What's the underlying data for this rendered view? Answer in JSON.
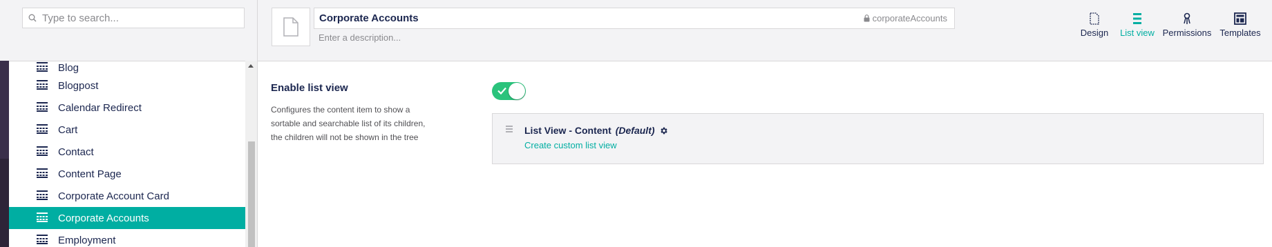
{
  "search": {
    "placeholder": "Type to search..."
  },
  "tree": {
    "items": [
      {
        "label": "Blog",
        "active": false
      },
      {
        "label": "Blogpost",
        "active": false
      },
      {
        "label": "Calendar Redirect",
        "active": false
      },
      {
        "label": "Cart",
        "active": false
      },
      {
        "label": "Contact",
        "active": false
      },
      {
        "label": "Content Page",
        "active": false
      },
      {
        "label": "Corporate Account Card",
        "active": false
      },
      {
        "label": "Corporate Accounts",
        "active": true
      },
      {
        "label": "Employment",
        "active": false
      }
    ]
  },
  "header": {
    "name": "Corporate Accounts",
    "alias": "corporateAccounts",
    "description_placeholder": "Enter a description..."
  },
  "apps": [
    {
      "label": "Design",
      "icon": "document-icon",
      "active": false
    },
    {
      "label": "List view",
      "icon": "list-icon",
      "active": true
    },
    {
      "label": "Permissions",
      "icon": "keychain-icon",
      "active": false
    },
    {
      "label": "Templates",
      "icon": "layout-icon",
      "active": false
    }
  ],
  "list_view": {
    "label": "Enable list view",
    "description": "Configures the content item to show a sortable and searchable list of its children, the children will not be shown in the tree",
    "enabled": true,
    "name": "List View - Content",
    "default_label": "(Default)",
    "create_link": "Create custom list view"
  },
  "colors": {
    "accent": "#00aea2",
    "toggle_on": "#2bc37c",
    "text": "#1b264f"
  }
}
